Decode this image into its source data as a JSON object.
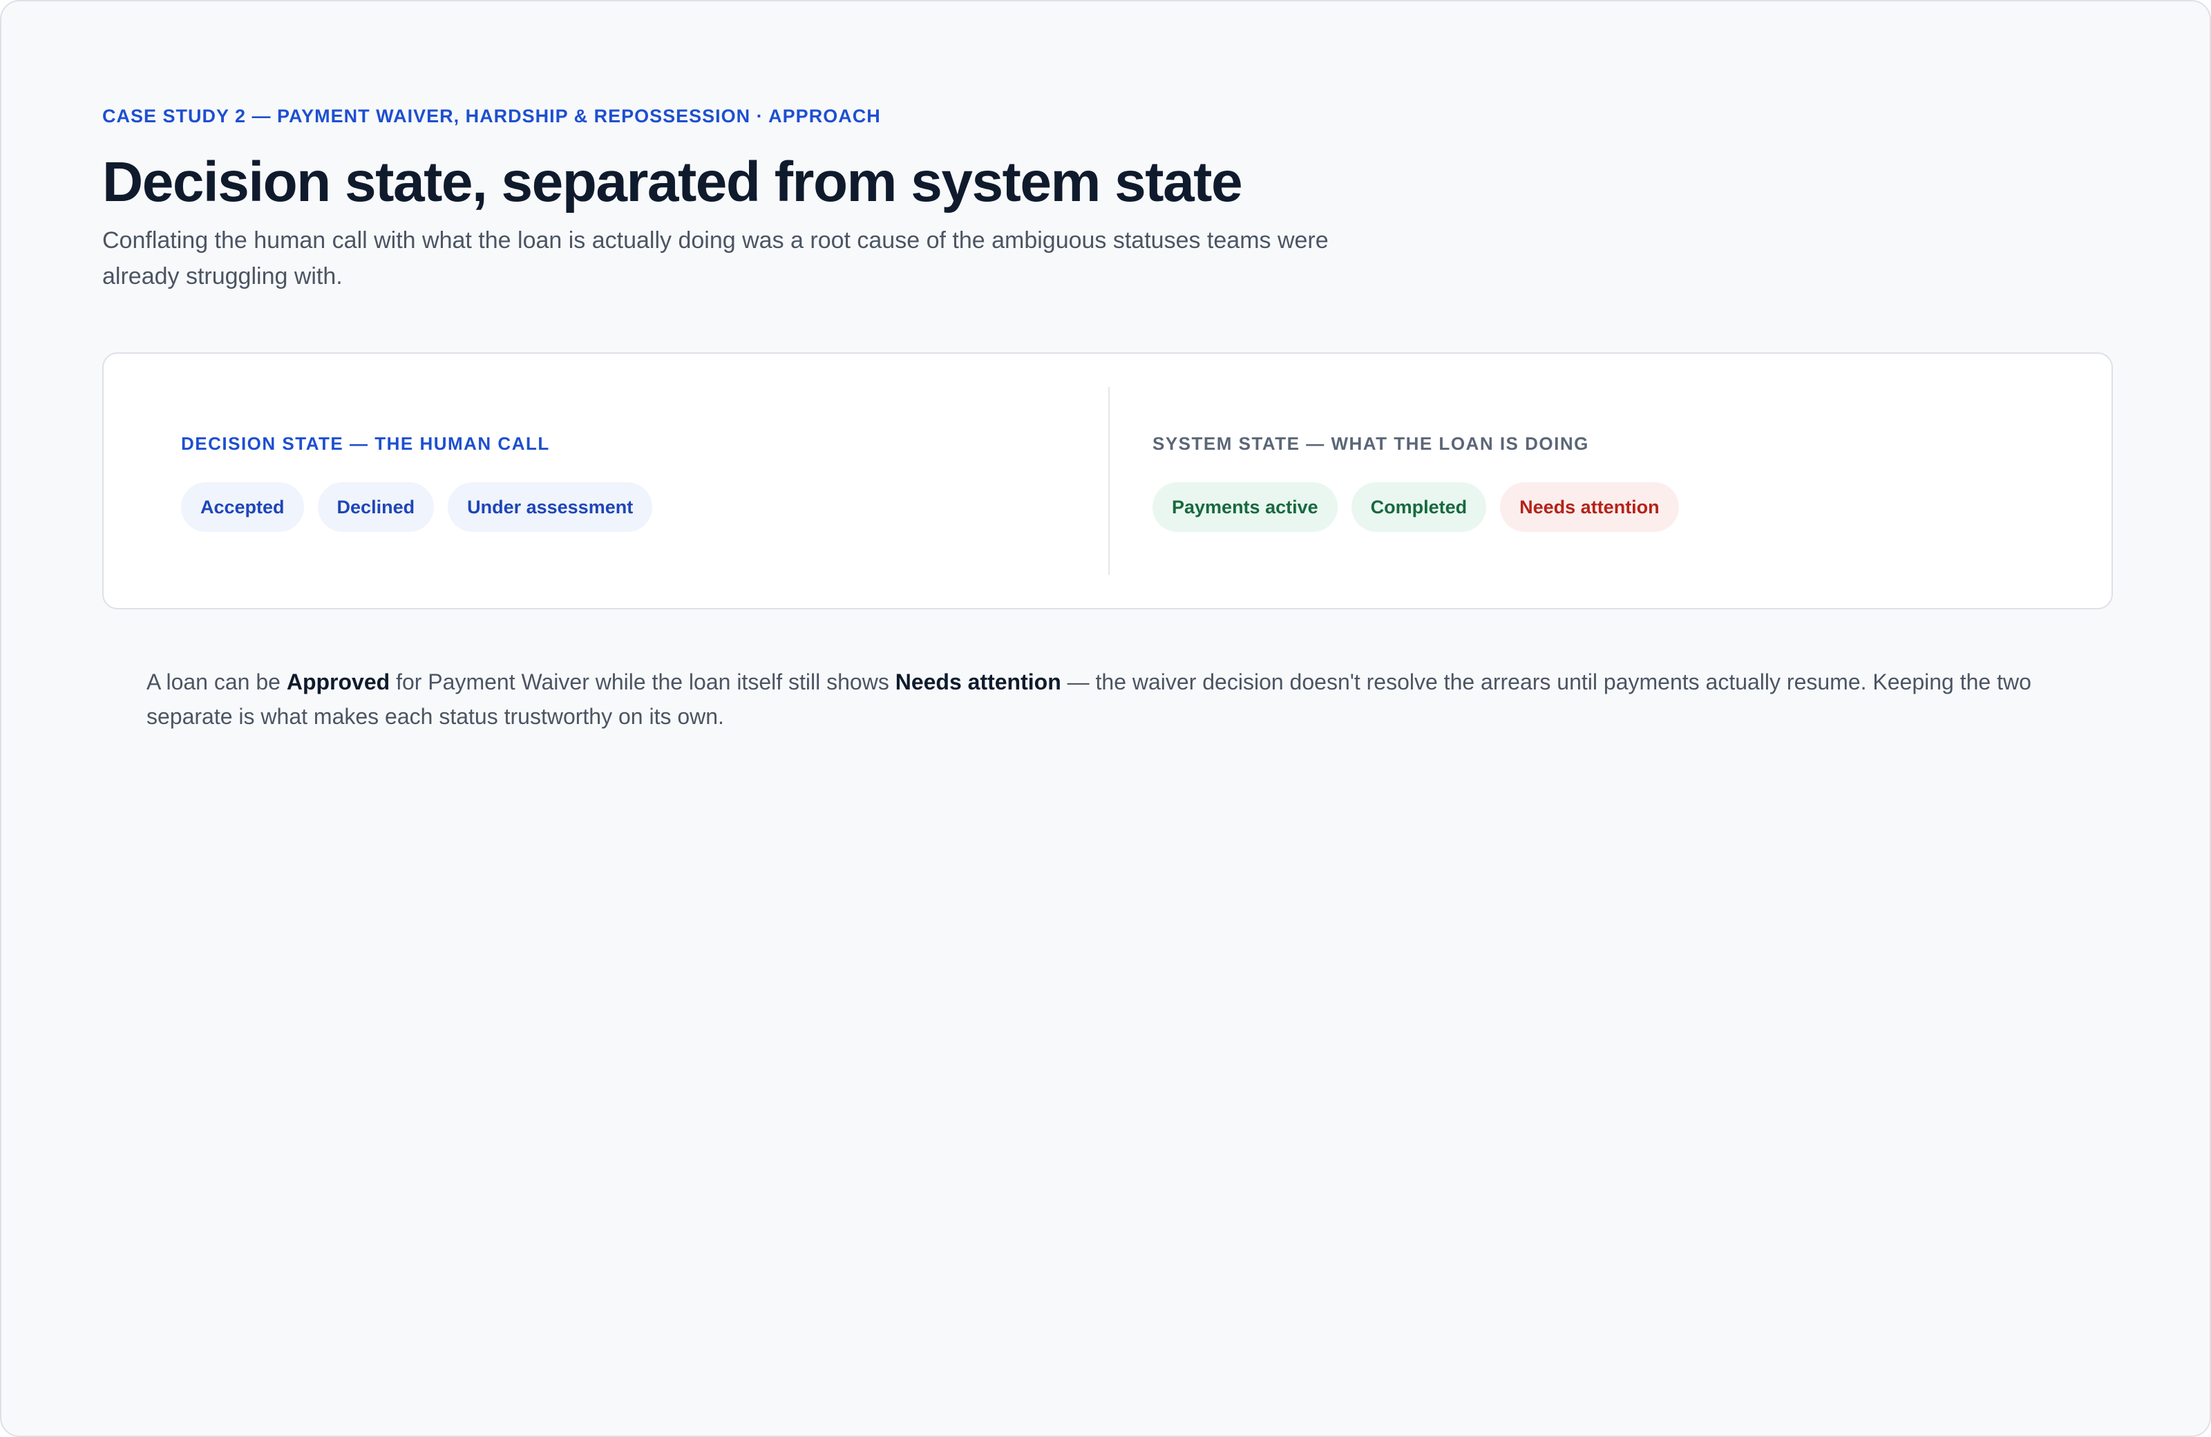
{
  "header": {
    "eyebrow": "CASE STUDY 2 — PAYMENT WAIVER, HARDSHIP & REPOSSESSION · APPROACH",
    "title": "Decision state, separated from system state",
    "subtitle": "Conflating the human call with what the loan is actually doing was a root cause of the ambiguous statuses teams were already struggling with."
  },
  "card": {
    "decision": {
      "heading": "DECISION STATE — THE HUMAN CALL",
      "chips": [
        {
          "label": "Accepted",
          "tone": "blue"
        },
        {
          "label": "Declined",
          "tone": "blue"
        },
        {
          "label": "Under assessment",
          "tone": "blue"
        }
      ]
    },
    "system": {
      "heading": "SYSTEM STATE — WHAT THE LOAN IS DOING",
      "chips": [
        {
          "label": "Payments active",
          "tone": "green"
        },
        {
          "label": "Completed",
          "tone": "green"
        },
        {
          "label": "Needs attention",
          "tone": "red"
        }
      ]
    }
  },
  "note": {
    "part1": "A loan can be ",
    "bold1": "Approved",
    "part2": " for Payment Waiver while the loan itself still shows ",
    "bold2": "Needs attention",
    "part3": " — the waiver decision doesn't resolve the arrears until payments actually resume. Keeping the two separate is what makes each status trustworthy on its own."
  },
  "colors": {
    "accent_blue": "#1d4fd0",
    "status_green": "#17693f",
    "status_red": "#b42318",
    "page_bg": "#f8f9fb"
  }
}
